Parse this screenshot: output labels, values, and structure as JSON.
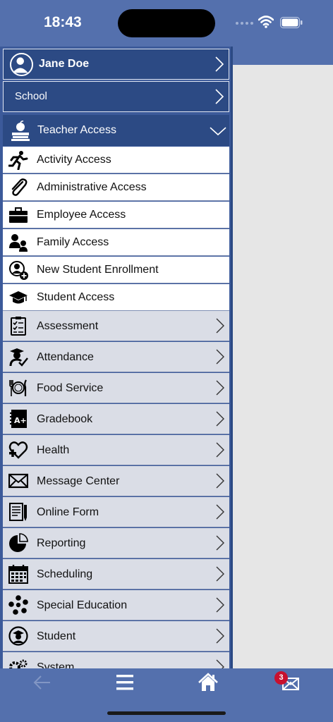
{
  "status_bar": {
    "time": "18:43"
  },
  "menu": {
    "user": {
      "name": "Jane Doe"
    },
    "school": {
      "label": "School"
    },
    "teacher_access": {
      "label": "Teacher Access",
      "subitems": [
        {
          "label": "Activity Access",
          "icon": "running-person-icon"
        },
        {
          "label": "Administrative Access",
          "icon": "paperclip-icon"
        },
        {
          "label": "Employee Access",
          "icon": "briefcase-icon"
        },
        {
          "label": "Family Access",
          "icon": "family-icon"
        },
        {
          "label": "New Student Enrollment",
          "icon": "add-person-icon"
        },
        {
          "label": "Student Access",
          "icon": "graduation-cap-icon"
        }
      ]
    },
    "items": [
      {
        "label": "Assessment",
        "icon": "checklist-icon"
      },
      {
        "label": "Attendance",
        "icon": "student-check-icon"
      },
      {
        "label": "Food Service",
        "icon": "plate-utensils-icon"
      },
      {
        "label": "Gradebook",
        "icon": "gradebook-a-plus-icon"
      },
      {
        "label": "Health",
        "icon": "heart-plus-icon"
      },
      {
        "label": "Message Center",
        "icon": "envelope-icon"
      },
      {
        "label": "Online Form",
        "icon": "form-pen-icon"
      },
      {
        "label": "Reporting",
        "icon": "pie-chart-icon"
      },
      {
        "label": "Scheduling",
        "icon": "calendar-icon"
      },
      {
        "label": "Special Education",
        "icon": "dots-cluster-icon"
      },
      {
        "label": "Student",
        "icon": "student-face-icon"
      },
      {
        "label": "System",
        "icon": "gears-icon"
      }
    ]
  },
  "tab_bar": {
    "message_badge": "3"
  },
  "colors": {
    "accent": "#5470ad",
    "menu_header": "#2c4a84",
    "menu_item": "#dadde6",
    "badge": "#c8102e"
  }
}
